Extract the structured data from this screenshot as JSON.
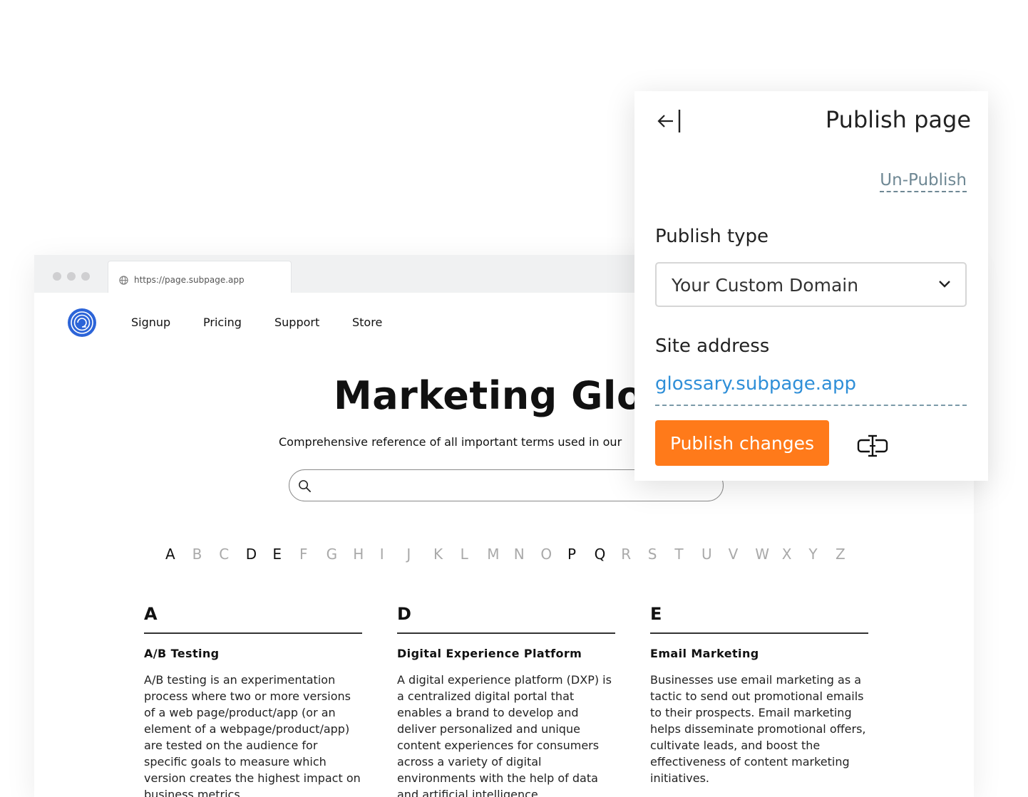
{
  "browser": {
    "url": "https://page.subpage.app"
  },
  "site": {
    "nav": [
      "Signup",
      "Pricing",
      "Support",
      "Store"
    ],
    "title": "Marketing Glossa",
    "subtitle": "Comprehensive reference of all important terms used in our",
    "search_placeholder": "",
    "alphabet": [
      {
        "l": "A",
        "on": true
      },
      {
        "l": "B",
        "on": false
      },
      {
        "l": "C",
        "on": false
      },
      {
        "l": "D",
        "on": true
      },
      {
        "l": "E",
        "on": true
      },
      {
        "l": "F",
        "on": false
      },
      {
        "l": "G",
        "on": false
      },
      {
        "l": "H",
        "on": false
      },
      {
        "l": "I",
        "on": false
      },
      {
        "l": "J",
        "on": false
      },
      {
        "l": "K",
        "on": false
      },
      {
        "l": "L",
        "on": false
      },
      {
        "l": "M",
        "on": false
      },
      {
        "l": "N",
        "on": false
      },
      {
        "l": "O",
        "on": false
      },
      {
        "l": "P",
        "on": true
      },
      {
        "l": "Q",
        "on": true
      },
      {
        "l": "R",
        "on": false
      },
      {
        "l": "S",
        "on": false
      },
      {
        "l": "T",
        "on": false
      },
      {
        "l": "U",
        "on": false
      },
      {
        "l": "V",
        "on": false
      },
      {
        "l": "W",
        "on": false
      },
      {
        "l": "X",
        "on": false
      },
      {
        "l": "Y",
        "on": false
      },
      {
        "l": "Z",
        "on": false
      }
    ],
    "columns": [
      {
        "heading": "A",
        "term": "A/B Testing",
        "definition": "A/B testing is an experimentation process where two or more versions of a web page/product/app (or an element of a webpage/product/app) are tested on the audience for specific goals to measure which version creates the highest impact on business metrics."
      },
      {
        "heading": "D",
        "term": "Digital Experience Platform",
        "definition": "A digital experience platform (DXP) is a centralized digital portal that enables a brand to develop and deliver personalized and unique content experiences for consumers across a variety of digital environments with the help of data and artificial intelligence."
      },
      {
        "heading": "E",
        "term": "Email Marketing",
        "definition": "Businesses use email marketing as a tactic to send out promotional emails to their prospects. Email marketing helps disseminate promotional offers, cultivate leads, and boost the effectiveness of content marketing initiatives."
      }
    ]
  },
  "panel": {
    "title": "Publish page",
    "unpublish": "Un-Publish",
    "publish_type_label": "Publish type",
    "publish_type_value": "Your Custom Domain",
    "site_address_label": "Site address",
    "site_address_value": "glossary.subpage.app",
    "publish_button": "Publish changes"
  },
  "colors": {
    "accent": "#ff7a1a",
    "link": "#2f8fd8",
    "logo": "#2c64d8"
  }
}
